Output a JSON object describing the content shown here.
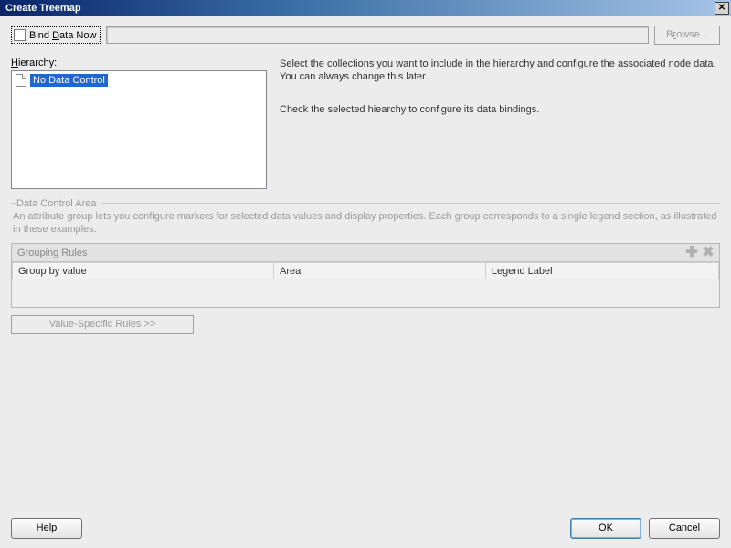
{
  "title": "Create Treemap",
  "topRow": {
    "bindDataNow_pre": "Bind ",
    "bindDataNow_u": "D",
    "bindDataNow_post": "ata Now",
    "browse_pre": "B",
    "browse_u": "r",
    "browse_post": "owse...",
    "path_value": ""
  },
  "hierarchy": {
    "label_pre": "",
    "label_u": "H",
    "label_post": "ierarchy:",
    "items": [
      {
        "label": "No Data Control"
      }
    ]
  },
  "info": {
    "line1": "Select the collections you want to include in the hierarchy and configure the associated node data. You can always change this later.",
    "line2": "Check the selected hiearchy to configure its data bindings."
  },
  "dataControlArea": {
    "legend": "Data Control Area",
    "desc": "An attribute group lets you configure markers for selected data values and display properties. Each group corresponds to a single legend section, as illustrated in these examples."
  },
  "grouping": {
    "title": "Grouping Rules",
    "columns": [
      "Group by value",
      "Area",
      "Legend Label"
    ]
  },
  "valueSpecificRules": "Value-Specific Rules >>",
  "buttons": {
    "help": "Help",
    "ok": "OK",
    "cancel": "Cancel"
  }
}
